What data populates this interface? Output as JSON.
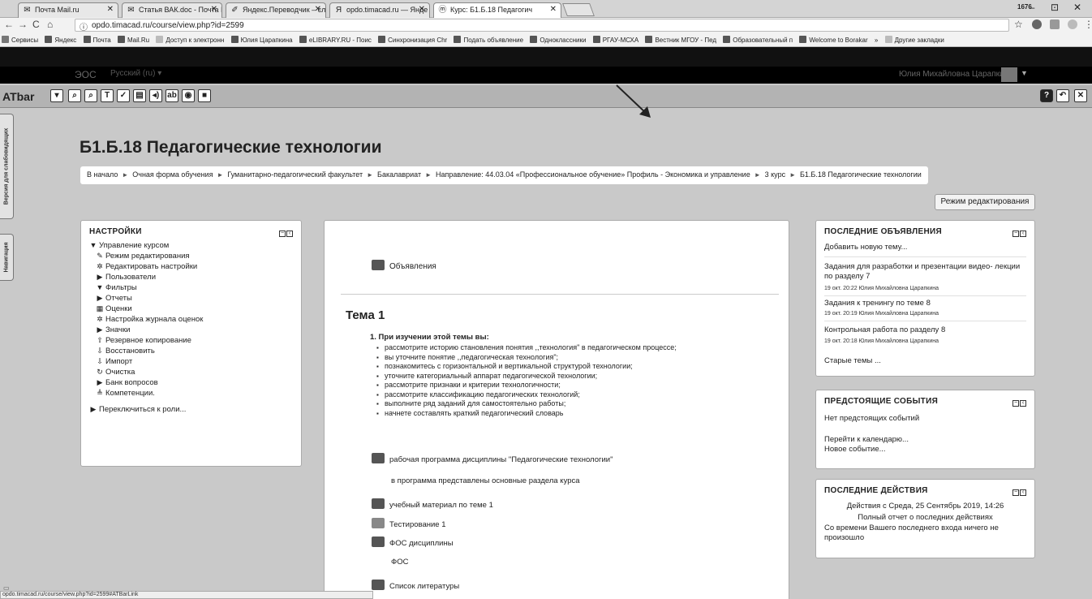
{
  "browser": {
    "tabs": [
      {
        "title": "Почта Mail.ru",
        "icon": "mail-icon"
      },
      {
        "title": "Статья ВАК.doc - Почта I",
        "icon": "mail-icon"
      },
      {
        "title": "Яндекс.Переводчик – сл",
        "icon": "translate-icon"
      },
      {
        "title": "opdo.timacad.ru — Янде",
        "icon": "yandex-icon"
      },
      {
        "title": "Курс: Б1.Б.18 Педагогич",
        "icon": "moodle-icon"
      }
    ],
    "user_badge": "1676",
    "window_controls": [
      "–",
      "⊡",
      "✕"
    ],
    "url": "opdo.timacad.ru/course/view.php?id=2599",
    "bookmarks": [
      "Сервисы",
      "Яндекс",
      "Почта",
      "Mail.Ru",
      "Доступ к электронн",
      "Юлия Царапкина",
      "eLIBRARY.RU - Поис",
      "Синхронизация Chr",
      "Подать объявление",
      "Одноклассники",
      "РГАУ-МСХА",
      "Вестник МГОУ - Пед",
      "Образовательный п",
      "Welcome to Borakar",
      "»",
      "Другие закладки"
    ]
  },
  "moodle_nav": {
    "brand": "ЭОС",
    "language": "Русский (ru) ▾",
    "user_name": "Юлия Михайловна Царапкина"
  },
  "atbar": {
    "label": "ATbar",
    "buttons": [
      "▾",
      "⌕",
      "⌕",
      "T",
      "✓",
      "▤",
      "◂)",
      "ab",
      "◉",
      "■"
    ],
    "right_buttons": [
      "?",
      "↶",
      "✕"
    ]
  },
  "side_tabs": {
    "version": "Версия для слабовидящих",
    "navigation": "Навигация"
  },
  "course": {
    "title": "Б1.Б.18 Педагогические технологии",
    "breadcrumb": [
      "В начало",
      "Очная форма обучения",
      "Гуманитарно-педагогический факультет",
      "Бакалавриат",
      "Направление: 44.03.04 «Профессиональное обучение» Профиль - Экономика и управление",
      "3 курс",
      "Б1.Б.18 Педагогические технологии"
    ],
    "edit_mode_button": "Режим редактирования"
  },
  "settings_block": {
    "title": "НАСТРОЙКИ",
    "items": [
      {
        "icon": "▼",
        "label": "Управление курсом",
        "level": 0
      },
      {
        "icon": "✎",
        "label": "Режим редактирования",
        "level": 1
      },
      {
        "icon": "✲",
        "label": "Редактировать настройки",
        "level": 1
      },
      {
        "icon": "▶",
        "label": "Пользователи",
        "level": 1
      },
      {
        "icon": "▼",
        "label": "Фильтры",
        "level": 1
      },
      {
        "icon": "▶",
        "label": "Отчеты",
        "level": 1
      },
      {
        "icon": "▦",
        "label": "Оценки",
        "level": 1
      },
      {
        "icon": "✲",
        "label": "Настройка журнала оценок",
        "level": 1
      },
      {
        "icon": "▶",
        "label": "Значки",
        "level": 1
      },
      {
        "icon": "⇧",
        "label": "Резервное копирование",
        "level": 1
      },
      {
        "icon": "⇩",
        "label": "Восстановить",
        "level": 1
      },
      {
        "icon": "⇩",
        "label": "Импорт",
        "level": 1
      },
      {
        "icon": "↻",
        "label": "Очистка",
        "level": 1
      },
      {
        "icon": "▶",
        "label": "Банк вопросов",
        "level": 1
      },
      {
        "icon": "≜",
        "label": "Компетенции.",
        "level": 1
      },
      {
        "icon": "▶",
        "label": "Переключиться к роли...",
        "level": 0
      }
    ]
  },
  "main": {
    "news": "Объявления",
    "topic_title": "Тема 1",
    "topic_head": "1. При изучении этой темы вы:",
    "bullets": [
      "рассмотрите историю становления понятия ,,технология\" в педагогическом процессе;",
      "вы уточните понятие ,,педагогическая технология\";",
      "познакомитесь с горизонтальной и вертикальной структурой технологии;",
      "уточните категориальный аппарат педагогической технологии;",
      "рассмотрите признаки и критерии технологичности;",
      "рассмотрите классификацию педагогических технологий;",
      "выполните ряд заданий для самостоятельно работы;",
      "начнете составлять краткий педагогический словарь"
    ],
    "resource1": "рабочая программа дисциплины \"Педагогические технологии\"",
    "resource1_desc": "в программа представлены основные раздела курса",
    "resource2": "учебный материал по теме 1",
    "resource3": "Тестирование 1",
    "resource4": "ФОС дисциплины",
    "resource4_desc": "ФОС",
    "resource5": "Список литературы"
  },
  "news_block": {
    "title": "ПОСЛЕДНИЕ ОБЪЯВЛЕНИЯ",
    "add": "Добавить новую тему...",
    "items": [
      {
        "text": "Задания для разработки и презентации видео- лекции по разделу 7",
        "meta": "19 окт. 20:22  Юлия Михайловна Царапкина"
      },
      {
        "text": "Задания к тренингу по теме 8",
        "meta": "19 окт. 20:19  Юлия Михайловна Царапкина"
      },
      {
        "text": "Контрольная работа по разделу 8",
        "meta": "19 окт. 20:18  Юлия Михайловна Царапкина"
      }
    ],
    "older": "Старые темы ..."
  },
  "events_block": {
    "title": "ПРЕДСТОЯЩИЕ СОБЫТИЯ",
    "none": "Нет предстоящих событий",
    "calendar": "Перейти к календарю...",
    "new_event": "Новое событие..."
  },
  "activity_block": {
    "title": "ПОСЛЕДНИЕ ДЕЙСТВИЯ",
    "since": "Действия с Среда, 25 Сентябрь 2019, 14:26",
    "full_report": "Полный отчет о последних действиях",
    "nothing": "Со времени Вашего последнего входа ничего не произошло"
  },
  "status_url": "opdo.timacad.ru/course/view.php?id=2599#ATBarLink"
}
